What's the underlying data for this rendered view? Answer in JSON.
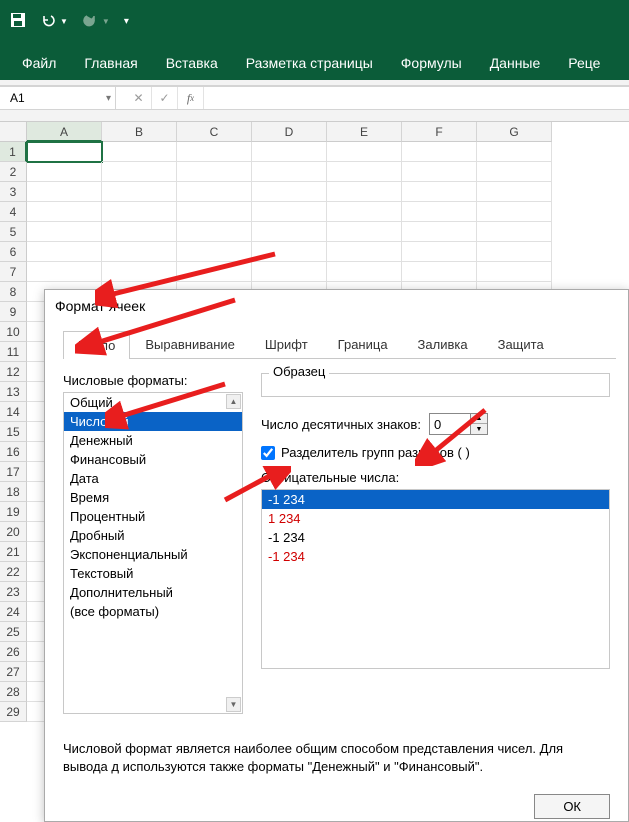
{
  "ribbon": {
    "tabs": [
      "Файл",
      "Главная",
      "Вставка",
      "Разметка страницы",
      "Формулы",
      "Данные",
      "Реце"
    ]
  },
  "name_box": "A1",
  "columns": [
    "A",
    "B",
    "C",
    "D",
    "E",
    "F",
    "G"
  ],
  "row_count": 29,
  "dialog": {
    "title": "Формат ячеек",
    "tabs": [
      "Число",
      "Выравнивание",
      "Шрифт",
      "Граница",
      "Заливка",
      "Защита"
    ],
    "active_tab": 0,
    "formats_label": "Числовые форматы:",
    "formats": [
      "Общий",
      "Числовой",
      "Денежный",
      "Финансовый",
      "Дата",
      "Время",
      "Процентный",
      "Дробный",
      "Экспоненциальный",
      "Текстовый",
      "Дополнительный",
      "(все форматы)"
    ],
    "selected_format_index": 1,
    "sample_label": "Образец",
    "decimals_label": "Число десятичных знаков:",
    "decimals_value": "0",
    "separator_label": "Разделитель групп разрядов ( )",
    "separator_checked": true,
    "negatives_label": "Отрицательные числа:",
    "negatives": [
      {
        "text": "-1 234",
        "style": "sel"
      },
      {
        "text": "1 234",
        "style": "red"
      },
      {
        "text": "-1 234",
        "style": ""
      },
      {
        "text": "-1 234",
        "style": "red"
      }
    ],
    "description": "Числовой формат является наиболее общим способом представления чисел. Для вывода д используются также форматы \"Денежный\" и \"Финансовый\".",
    "ok": "ОК"
  }
}
